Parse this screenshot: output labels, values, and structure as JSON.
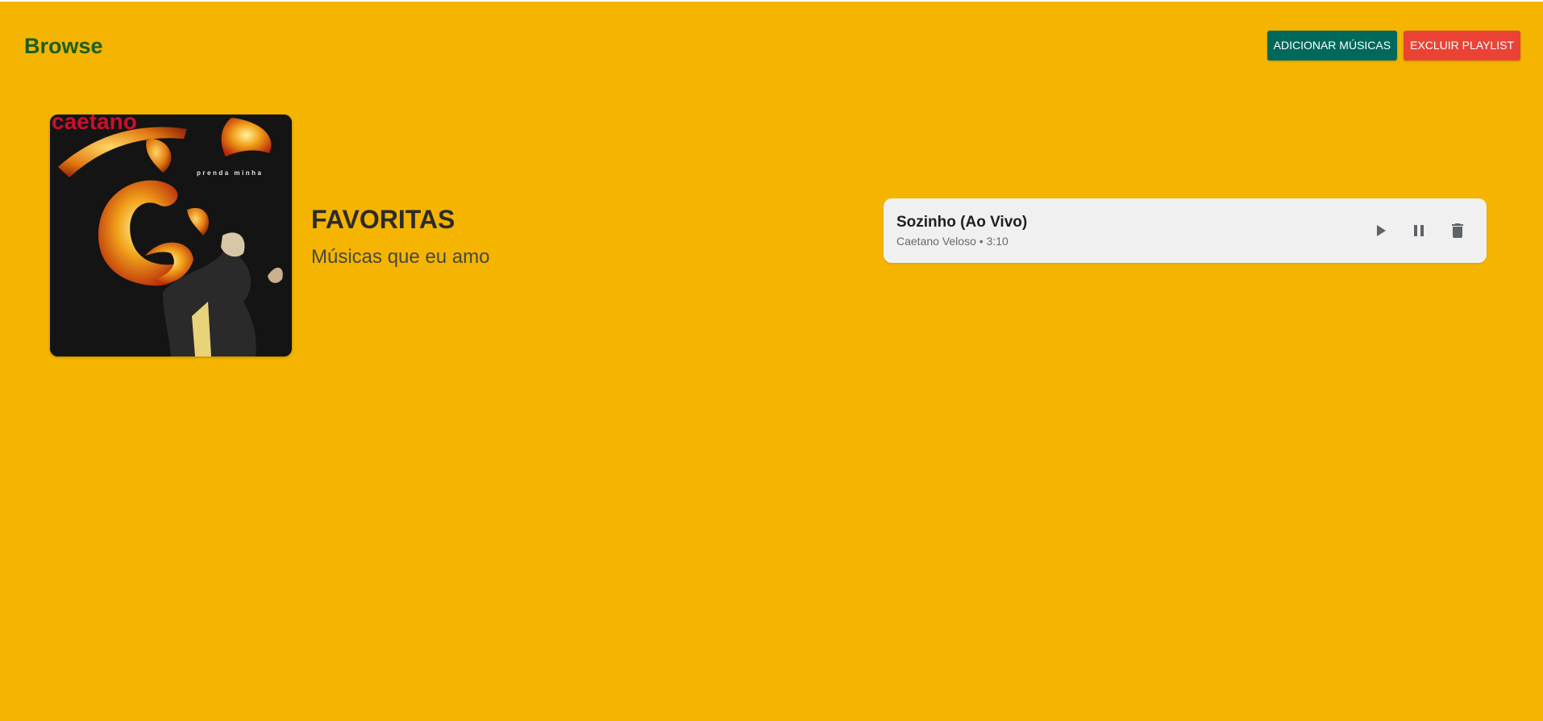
{
  "header": {
    "brand": "Browse",
    "add_songs_label": "ADICIONAR MÚSICAS",
    "delete_playlist_label": "EXCLUIR PLAYLIST"
  },
  "playlist": {
    "title": "FAVORITAS",
    "description": "Músicas que eu amo",
    "cover": {
      "artist_text": "caetano",
      "album_text": "prenda minha"
    }
  },
  "tracks": [
    {
      "title": "Sozinho (Ao Vivo)",
      "artist": "Caetano Veloso",
      "separator": "•",
      "duration": "3:10",
      "actions": [
        {
          "icon": "play-icon"
        },
        {
          "icon": "pause-icon"
        },
        {
          "icon": "delete-icon"
        }
      ]
    }
  ],
  "colors": {
    "background": "#f4b400",
    "brand": "#1b5e20",
    "add_button": "#00695c",
    "delete_button": "#ea4335",
    "card": "#f0f0f0"
  }
}
